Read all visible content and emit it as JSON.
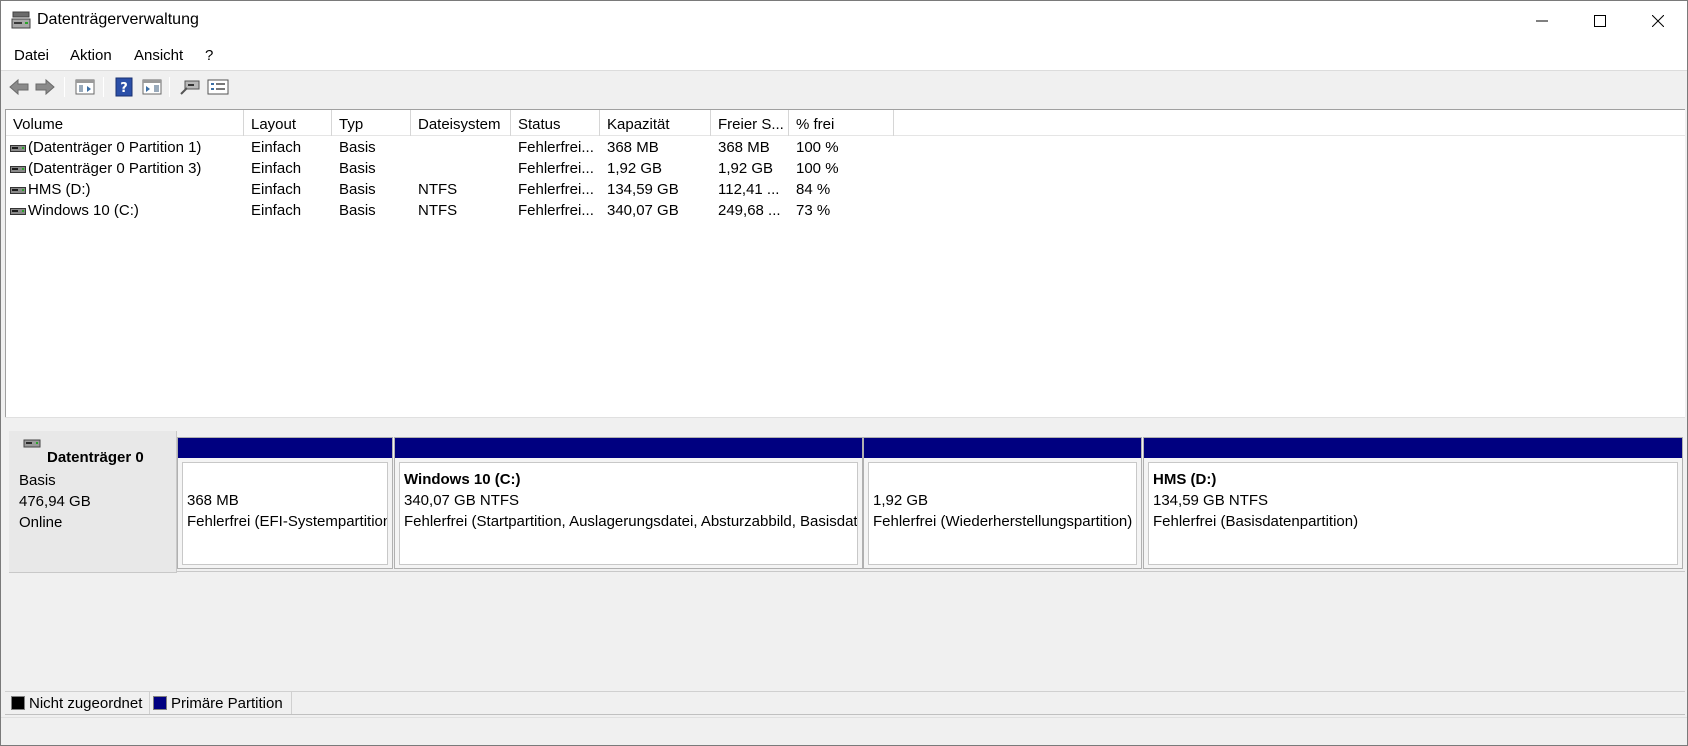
{
  "window": {
    "title": "Datenträgerverwaltung",
    "controls": [
      "minimize",
      "maximize",
      "close"
    ]
  },
  "menu": [
    "Datei",
    "Aktion",
    "Ansicht",
    "?"
  ],
  "toolbar": {
    "icons": [
      "back-arrow-icon",
      "forward-arrow-icon",
      "console-tree-icon",
      "help-icon",
      "action-pane-icon",
      "disk-properties-icon",
      "disk-list-icon"
    ]
  },
  "columns": [
    "Volume",
    "Layout",
    "Typ",
    "Dateisystem",
    "Status",
    "Kapazität",
    "Freier S...",
    "% frei"
  ],
  "volumes": [
    {
      "volume": "(Datenträger 0 Partition 1)",
      "layout": "Einfach",
      "type": "Basis",
      "filesystem": "",
      "status": "Fehlerfrei...",
      "capacity": "368 MB",
      "free": "368 MB",
      "percent": "100 %"
    },
    {
      "volume": "(Datenträger 0 Partition 3)",
      "layout": "Einfach",
      "type": "Basis",
      "filesystem": "",
      "status": "Fehlerfrei...",
      "capacity": "1,92 GB",
      "free": "1,92 GB",
      "percent": "100 %"
    },
    {
      "volume": "HMS (D:)",
      "layout": "Einfach",
      "type": "Basis",
      "filesystem": "NTFS",
      "status": "Fehlerfrei...",
      "capacity": "134,59 GB",
      "free": "112,41 ...",
      "percent": "84 %"
    },
    {
      "volume": "Windows 10 (C:)",
      "layout": "Einfach",
      "type": "Basis",
      "filesystem": "NTFS",
      "status": "Fehlerfrei...",
      "capacity": "340,07 GB",
      "free": "249,68 ...",
      "percent": "73 %"
    }
  ],
  "disk": {
    "name": "Datenträger 0",
    "type": "Basis",
    "size": "476,94 GB",
    "state": "Online"
  },
  "partitions": [
    {
      "title": "",
      "size": "368 MB",
      "status": "Fehlerfrei (EFI-Systempartition)"
    },
    {
      "title": "Windows 10  (C:)",
      "size": "340,07 GB NTFS",
      "status": "Fehlerfrei (Startpartition, Auslagerungsdatei, Absturzabbild, Basisdatenpartition)"
    },
    {
      "title": "",
      "size": "1,92 GB",
      "status": "Fehlerfrei (Wiederherstellungspartition)"
    },
    {
      "title": "HMS  (D:)",
      "size": "134,59 GB NTFS",
      "status": "Fehlerfrei (Basisdatenpartition)"
    }
  ],
  "legend": [
    {
      "label": "Nicht zugeordnet",
      "color": "#000000"
    },
    {
      "label": "Primäre Partition",
      "color": "#000080"
    }
  ],
  "colors": {
    "primary_partition": "#000080",
    "unallocated": "#000000"
  }
}
